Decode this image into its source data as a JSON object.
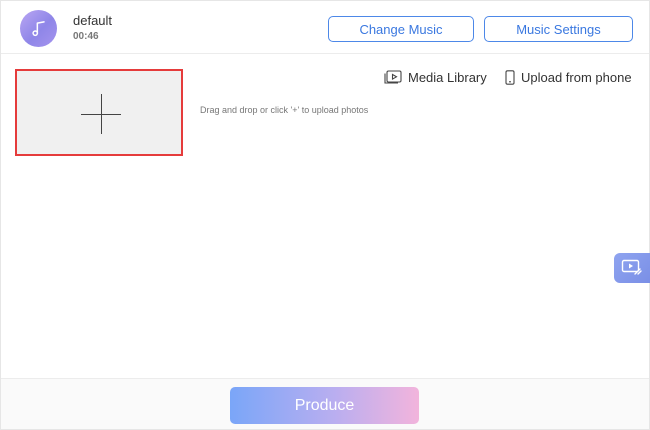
{
  "header": {
    "track_name": "default",
    "track_time": "00:46",
    "change_music_label": "Change Music",
    "music_settings_label": "Music Settings"
  },
  "upload": {
    "media_library_label": "Media Library",
    "upload_phone_label": "Upload from phone",
    "hint": "Drag and drop or click '+' to upload photos"
  },
  "footer": {
    "produce_label": "Produce"
  },
  "icons": {
    "avatar": "music-note-icon",
    "media_library": "media-library-icon",
    "phone": "phone-icon",
    "plus": "plus-icon",
    "side_tab": "screen-tutorial-icon"
  },
  "colors": {
    "accent_blue": "#3a78e0",
    "selection_red": "#e53b3b",
    "produce_gradient_start": "#7aa6f8",
    "produce_gradient_end": "#f2b4dc"
  }
}
